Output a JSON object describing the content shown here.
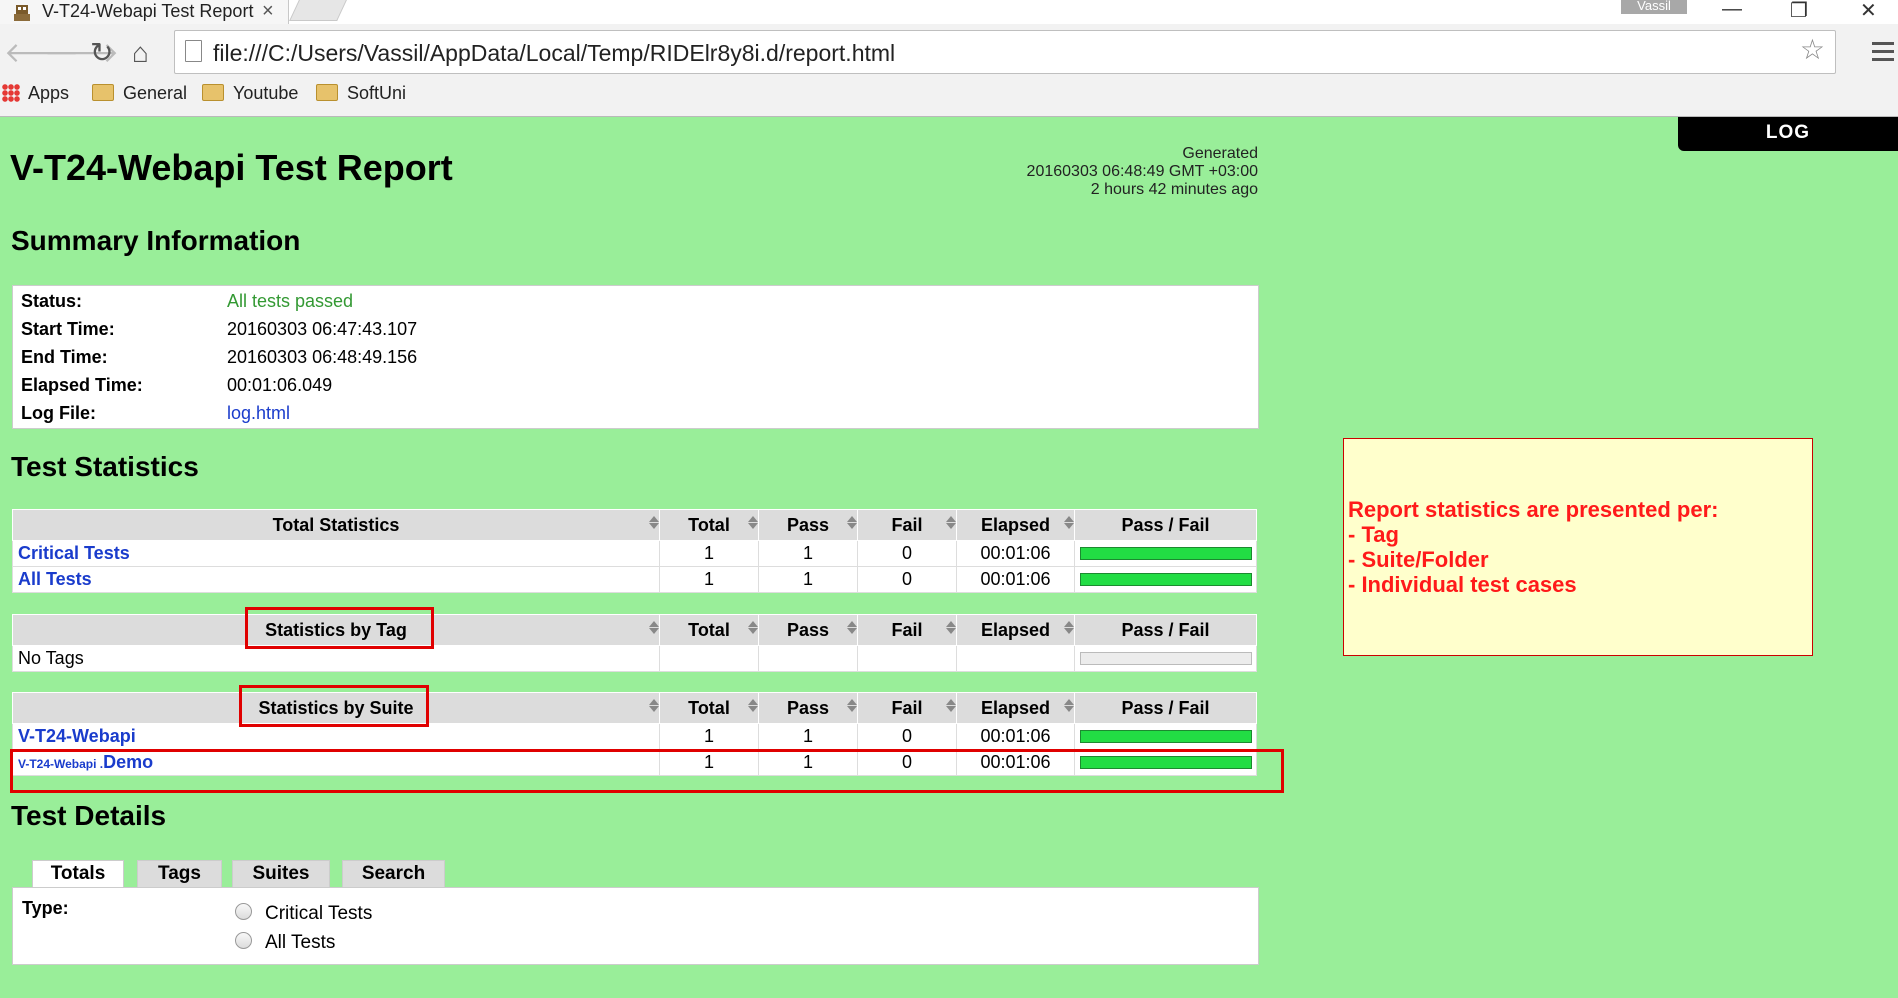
{
  "browser": {
    "tab_title": "V-T24-Webapi Test Report",
    "tab_close": "×",
    "user_badge": "Vassil",
    "url": "file:///C:/Users/Vassil/AppData/Local/Temp/RIDElr8y8i.d/report.html",
    "bookmarks": [
      "Apps",
      "General",
      "Youtube",
      "SoftUni"
    ],
    "win_minimize": "—",
    "win_restore": "❐",
    "win_close": "✕"
  },
  "report": {
    "log_button": "LOG",
    "title": "V-T24-Webapi Test Report",
    "generated_label": "Generated",
    "generated_time": "20160303 06:48:49 GMT +03:00",
    "generated_ago": "2 hours 42 minutes ago"
  },
  "summary": {
    "heading": "Summary Information",
    "rows": [
      {
        "label": "Status:",
        "value": "All tests passed"
      },
      {
        "label": "Start Time:",
        "value": "20160303 06:47:43.107"
      },
      {
        "label": "End Time:",
        "value": "20160303 06:48:49.156"
      },
      {
        "label": "Elapsed Time:",
        "value": "00:01:06.049"
      },
      {
        "label": "Log File:",
        "value": "log.html"
      }
    ]
  },
  "statistics": {
    "heading": "Test Statistics",
    "columns": [
      "Total",
      "Pass",
      "Fail",
      "Elapsed",
      "Pass / Fail"
    ],
    "total": {
      "title": "Total Statistics",
      "rows": [
        {
          "name": "Critical Tests",
          "total": "1",
          "pass": "1",
          "fail": "0",
          "elapsed": "00:01:06",
          "pass_ratio": 1
        },
        {
          "name": "All Tests",
          "total": "1",
          "pass": "1",
          "fail": "0",
          "elapsed": "00:01:06",
          "pass_ratio": 1
        }
      ]
    },
    "tag": {
      "title": "Statistics by Tag",
      "rows": [
        {
          "name": "No Tags",
          "total": "",
          "pass": "",
          "fail": "",
          "elapsed": "",
          "pass_ratio": 0
        }
      ]
    },
    "suite": {
      "title": "Statistics by Suite",
      "rows": [
        {
          "name": "V-T24-Webapi",
          "total": "1",
          "pass": "1",
          "fail": "0",
          "elapsed": "00:01:06",
          "pass_ratio": 1
        },
        {
          "parent": "V-T24-Webapi .",
          "name": "Demo",
          "total": "1",
          "pass": "1",
          "fail": "0",
          "elapsed": "00:01:06",
          "pass_ratio": 1
        }
      ]
    }
  },
  "callout": {
    "lines": [
      "Report statistics are presented per:",
      "- Tag",
      "- Suite/Folder",
      "- Individual test cases"
    ]
  },
  "details": {
    "heading": "Test Details",
    "tabs": [
      "Totals",
      "Tags",
      "Suites",
      "Search"
    ],
    "type_label": "Type:",
    "options": [
      "Critical Tests",
      "All Tests"
    ]
  },
  "colors": {
    "page_background": "#99ee99",
    "pass_bar": "#22dd44",
    "annotation_red": "#e00000",
    "link": "#1a3ccc"
  }
}
